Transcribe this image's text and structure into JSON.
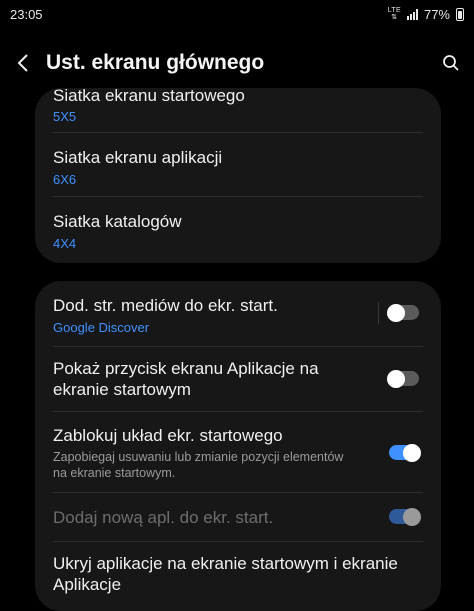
{
  "status": {
    "time": "23:05",
    "network": "LTE",
    "battery": "77%"
  },
  "header": {
    "title": "Ust. ekranu głównego"
  },
  "grid_settings": [
    {
      "label": "Siatka ekranu startowego",
      "value": "5X5"
    },
    {
      "label": "Siatka ekranu aplikacji",
      "value": "6X6"
    },
    {
      "label": "Siatka katalogów",
      "value": "4X4"
    }
  ],
  "toggles": [
    {
      "label": "Dod. str. mediów do ekr. start.",
      "sub": "Google Discover",
      "state": "off"
    },
    {
      "label_line1": "Pokaż przycisk ekranu Aplikacje na",
      "label_line2": "ekranie startowym",
      "state": "off"
    },
    {
      "label": "Zablokuj układ ekr. startowego",
      "sub_line1": "Zapobiegaj usuwaniu lub zmianie pozycji elementów",
      "sub_line2": "na ekranie startowym.",
      "state": "on"
    },
    {
      "label": "Dodaj nową apl. do ekr. start.",
      "state": "on-disabled"
    }
  ],
  "hide_apps": {
    "line1": "Ukryj aplikacje na ekranie startowym i ekranie",
    "line2": "Aplikacje"
  },
  "colors": {
    "accent": "#3e91ff",
    "card": "#171717",
    "background": "#000000"
  }
}
